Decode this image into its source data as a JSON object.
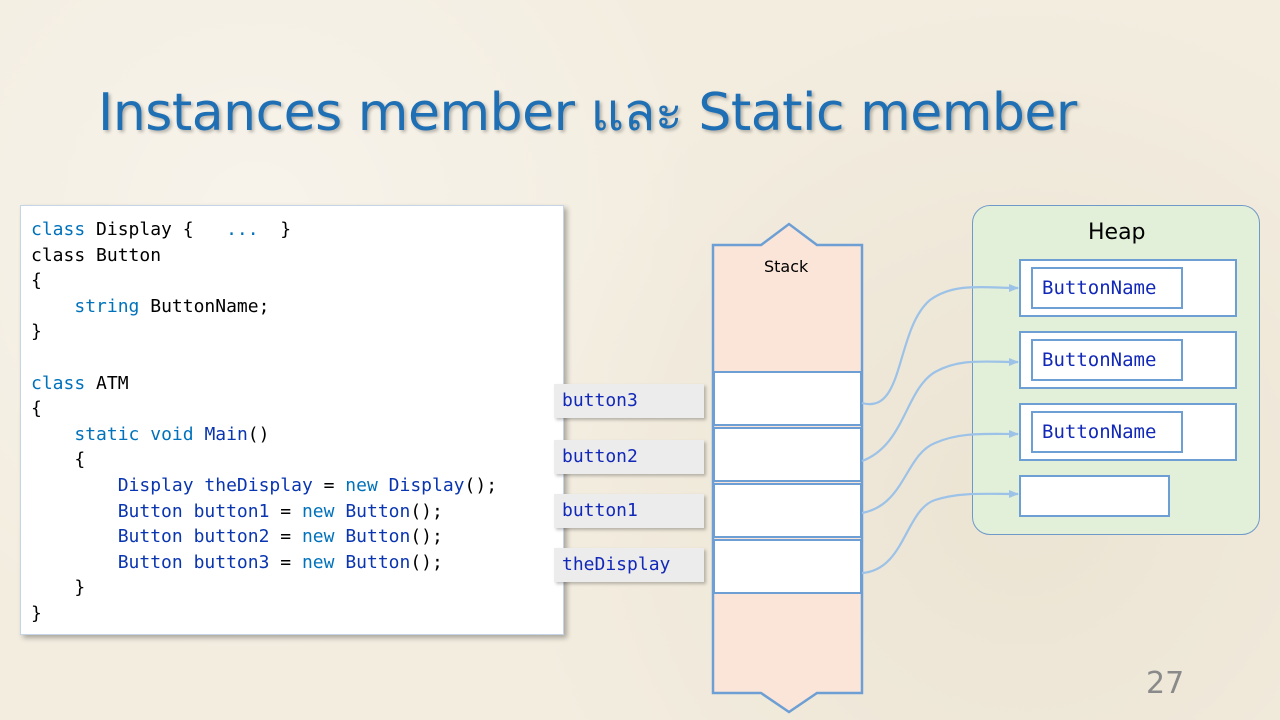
{
  "title": "Instances member และ Static member",
  "page_number": "27",
  "code_lines": [
    [
      [
        "kw",
        "class"
      ],
      [
        "plain",
        " Display {   "
      ],
      [
        "kw",
        "..."
      ],
      [
        "plain",
        "  }"
      ]
    ],
    [
      [
        "plain",
        "class Button"
      ]
    ],
    [
      [
        "plain",
        "{"
      ]
    ],
    [
      [
        "plain",
        "    "
      ],
      [
        "kw",
        "string"
      ],
      [
        "plain",
        " ButtonName;"
      ]
    ],
    [
      [
        "plain",
        "}"
      ]
    ],
    [
      [
        "plain",
        ""
      ]
    ],
    [
      [
        "kw",
        "class"
      ],
      [
        "plain",
        " ATM"
      ]
    ],
    [
      [
        "plain",
        "{"
      ]
    ],
    [
      [
        "plain",
        "    "
      ],
      [
        "kw",
        "static"
      ],
      [
        "plain",
        " "
      ],
      [
        "kw",
        "void"
      ],
      [
        "plain",
        " "
      ],
      [
        "type",
        "Main"
      ],
      [
        "plain",
        "()"
      ]
    ],
    [
      [
        "plain",
        "    {"
      ]
    ],
    [
      [
        "plain",
        "        "
      ],
      [
        "type",
        "Display"
      ],
      [
        "plain",
        " "
      ],
      [
        "type",
        "theDisplay"
      ],
      [
        "plain",
        " = "
      ],
      [
        "kw",
        "new"
      ],
      [
        "plain",
        " "
      ],
      [
        "type",
        "Display"
      ],
      [
        "plain",
        "();"
      ]
    ],
    [
      [
        "plain",
        "        "
      ],
      [
        "type",
        "Button"
      ],
      [
        "plain",
        " "
      ],
      [
        "type",
        "button1"
      ],
      [
        "plain",
        " = "
      ],
      [
        "kw",
        "new"
      ],
      [
        "plain",
        " "
      ],
      [
        "type",
        "Button"
      ],
      [
        "plain",
        "();"
      ]
    ],
    [
      [
        "plain",
        "        "
      ],
      [
        "type",
        "Button"
      ],
      [
        "plain",
        " "
      ],
      [
        "type",
        "button2"
      ],
      [
        "plain",
        " = "
      ],
      [
        "kw",
        "new"
      ],
      [
        "plain",
        " "
      ],
      [
        "type",
        "Button"
      ],
      [
        "plain",
        "();"
      ]
    ],
    [
      [
        "plain",
        "        "
      ],
      [
        "type",
        "Button"
      ],
      [
        "plain",
        " "
      ],
      [
        "type",
        "button3"
      ],
      [
        "plain",
        " = "
      ],
      [
        "kw",
        "new"
      ],
      [
        "plain",
        " "
      ],
      [
        "type",
        "Button"
      ],
      [
        "plain",
        "();"
      ]
    ],
    [
      [
        "plain",
        "    }"
      ]
    ],
    [
      [
        "plain",
        "}"
      ]
    ]
  ],
  "stack": {
    "label": "Stack",
    "variables": [
      "button3",
      "button2",
      "button1",
      "theDisplay"
    ]
  },
  "heap": {
    "label": "Heap",
    "objects": [
      "ButtonName",
      "ButtonName",
      "ButtonName"
    ]
  },
  "colors": {
    "title": "#1e6fb4",
    "keyword": "#0072bc",
    "identifier": "#0a35b0",
    "border": "#6e9fd4",
    "arrow": "#9cc2e8",
    "stack_fill": "#fae5d8",
    "heap_fill": "#e2efd9"
  }
}
